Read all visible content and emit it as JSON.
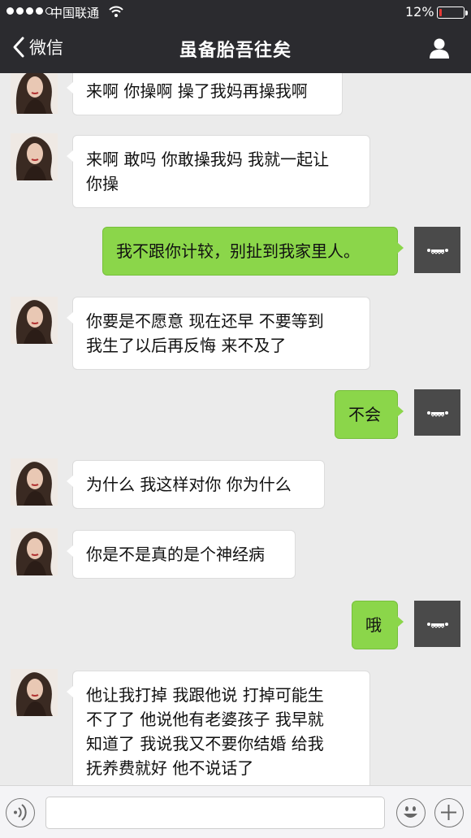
{
  "status_bar": {
    "carrier": "中国联通",
    "battery_percent": "12%",
    "battery_level": 0.12,
    "battery_color": "#e53935"
  },
  "nav": {
    "back_label": "微信",
    "title": "虽备胎吾往矣",
    "back_icon": "chevron-left-icon",
    "profile_icon": "person-icon"
  },
  "colors": {
    "nav_bg": "#2b2b2f",
    "chat_bg": "#ebebeb",
    "sent_bubble": "#8bd64a",
    "received_bubble": "#ffffff"
  },
  "messages": [
    {
      "from": "her",
      "text": "来啊 你操啊 操了我妈再操我啊"
    },
    {
      "from": "her",
      "text": "来啊 敢吗 你敢操我妈 我就一起让\n你操"
    },
    {
      "from": "me",
      "text": "我不跟你计较，别扯到我家里人。"
    },
    {
      "from": "her",
      "text": "你要是不愿意 现在还早 不要等到\n我生了以后再反悔 来不及了"
    },
    {
      "from": "me",
      "text": "不会"
    },
    {
      "from": "her",
      "text": "为什么 我这样对你 你为什么"
    },
    {
      "from": "her",
      "text": "你是不是真的是个神经病"
    },
    {
      "from": "me",
      "text": "哦"
    },
    {
      "from": "her",
      "text": "他让我打掉 我跟他说 打掉可能生\n不了了 他说他有老婆孩子 我早就\n知道了 我说我又不要你结婚 给我\n抚养费就好 他不说话了"
    }
  ],
  "input_bar": {
    "voice_icon": "voice-icon",
    "emoji_icon": "emoji-icon",
    "plus_icon": "plus-icon",
    "text_value": ""
  }
}
